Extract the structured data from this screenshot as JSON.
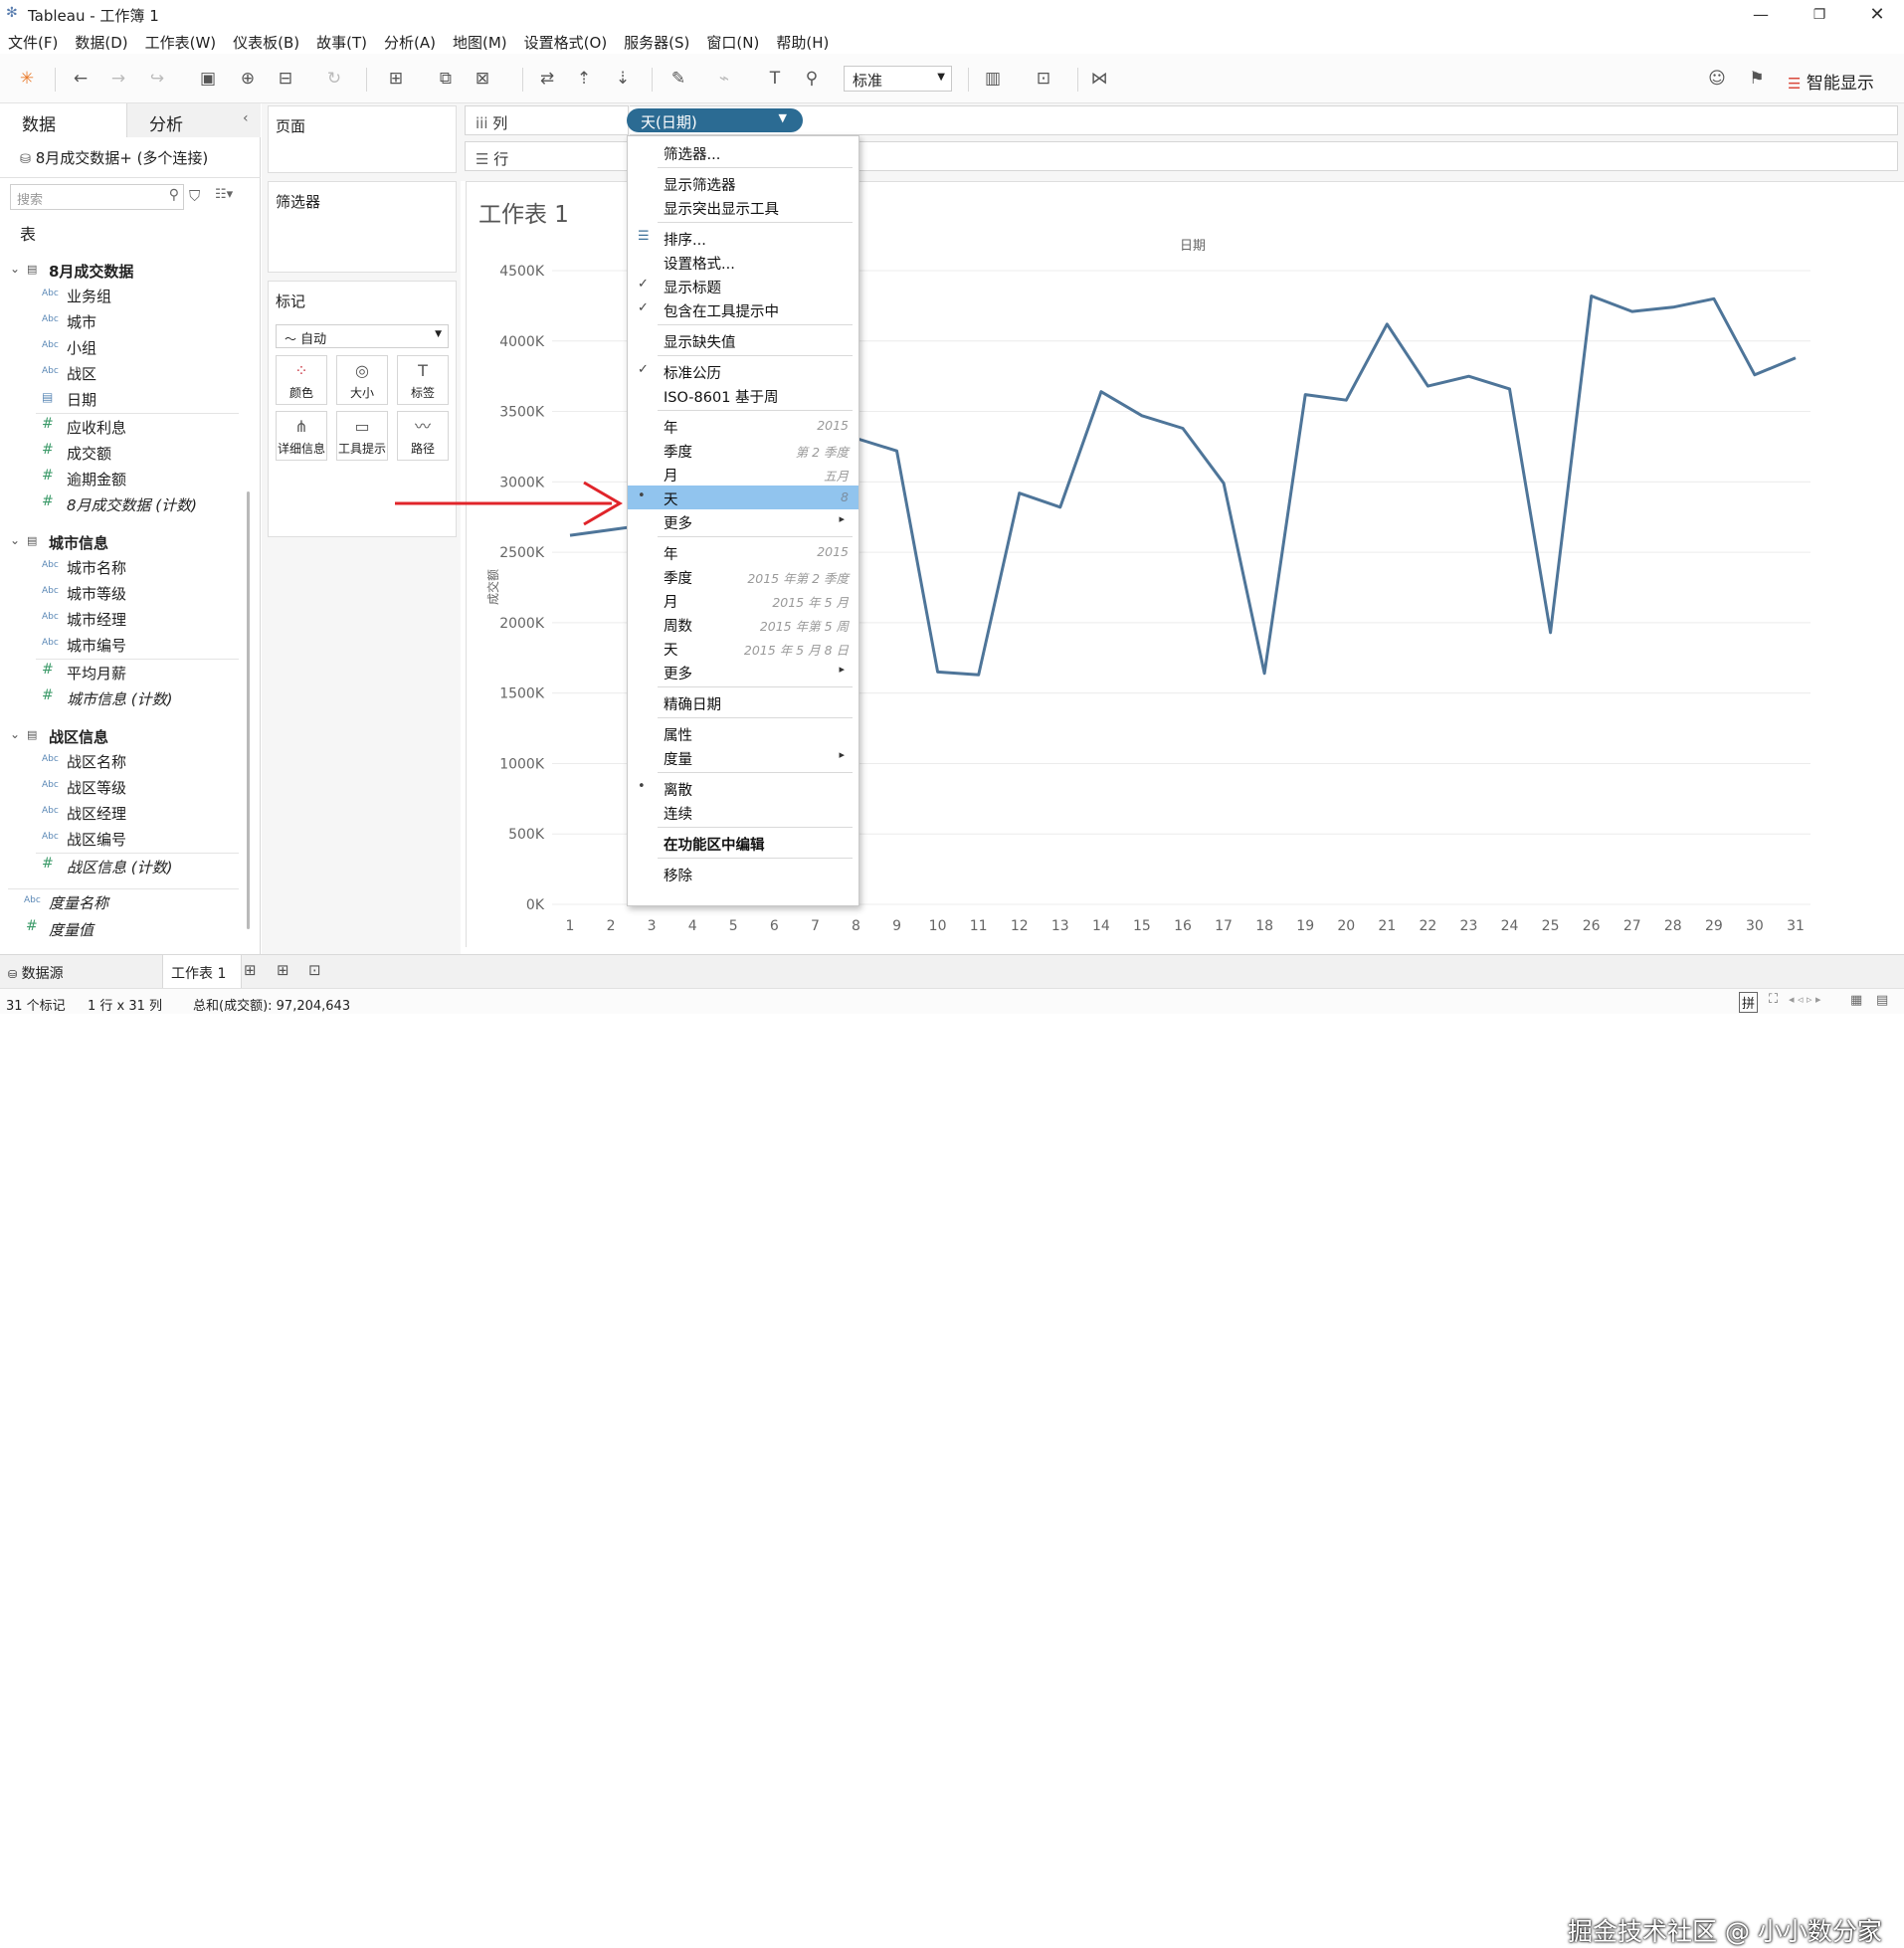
{
  "window": {
    "title": "Tableau - 工作簿 1"
  },
  "menubar": [
    "文件(F)",
    "数据(D)",
    "工作表(W)",
    "仪表板(B)",
    "故事(T)",
    "分析(A)",
    "地图(M)",
    "设置格式(O)",
    "服务器(S)",
    "窗口(N)",
    "帮助(H)"
  ],
  "toolbar": {
    "fit_select": "标准",
    "smart_show": "智能显示"
  },
  "left_panel": {
    "tab_data": "数据",
    "tab_analysis": "分析",
    "datasource": "8月成交数据+ (多个连接)",
    "search_placeholder": "搜索",
    "tables_label": "表",
    "tables": [
      {
        "name": "8月成交数据",
        "fields": [
          {
            "type": "Abc",
            "name": "业务组"
          },
          {
            "type": "Abc",
            "name": "城市"
          },
          {
            "type": "Abc",
            "name": "小组"
          },
          {
            "type": "Abc",
            "name": "战区"
          },
          {
            "type": "date",
            "name": "日期"
          },
          {
            "type": "#",
            "name": "应收利息"
          },
          {
            "type": "#",
            "name": "成交额"
          },
          {
            "type": "#",
            "name": "逾期金额"
          },
          {
            "type": "#",
            "name": "8月成交数据 (计数)"
          }
        ]
      },
      {
        "name": "城市信息",
        "fields": [
          {
            "type": "Abc",
            "name": "城市名称"
          },
          {
            "type": "Abc",
            "name": "城市等级"
          },
          {
            "type": "Abc",
            "name": "城市经理"
          },
          {
            "type": "Abc",
            "name": "城市编号"
          },
          {
            "type": "#",
            "name": "平均月薪"
          },
          {
            "type": "#",
            "name": "城市信息 (计数)"
          }
        ]
      },
      {
        "name": "战区信息",
        "fields": [
          {
            "type": "Abc",
            "name": "战区名称"
          },
          {
            "type": "Abc",
            "name": "战区等级"
          },
          {
            "type": "Abc",
            "name": "战区经理"
          },
          {
            "type": "Abc",
            "name": "战区编号"
          },
          {
            "type": "#",
            "name": "战区信息 (计数)"
          }
        ]
      }
    ],
    "measure_names": "度量名称",
    "measure_values": "度量值"
  },
  "shelves": {
    "pages": "页面",
    "filters": "筛选器",
    "marks": "标记",
    "mark_type": "自动",
    "mark_buttons": [
      "颜色",
      "大小",
      "标签",
      "详细信息",
      "工具提示",
      "路径"
    ],
    "columns": "列",
    "rows": "行",
    "column_pill": "天(日期)"
  },
  "sheet": {
    "title": "工作表 1"
  },
  "chart_data": {
    "type": "line",
    "title": "",
    "xlabel": "日期",
    "ylabel": "成交额",
    "x": [
      1,
      2,
      3,
      4,
      5,
      6,
      7,
      8,
      9,
      10,
      11,
      12,
      13,
      14,
      15,
      16,
      17,
      18,
      19,
      20,
      21,
      22,
      23,
      24,
      25,
      26,
      27,
      28,
      29,
      30,
      31
    ],
    "series": [
      {
        "name": "",
        "values": [
          2620,
          2660,
          2700,
          2900,
          3050,
          3150,
          3220,
          3310,
          3220,
          1650,
          1630,
          2920,
          2820,
          3640,
          3470,
          3380,
          2990,
          1640,
          3620,
          3580,
          4120,
          3680,
          3750,
          3660,
          1930,
          4320,
          4210,
          4240,
          4300,
          3760,
          3880
        ]
      }
    ],
    "ylim": [
      0,
      4500
    ],
    "yticks": [
      "0K",
      "500K",
      "1000K",
      "1500K",
      "2000K",
      "2500K",
      "3000K",
      "3500K",
      "4000K",
      "4500K"
    ],
    "line_color": "#4e7599",
    "grid": true
  },
  "context_menu": {
    "items": [
      {
        "label": "筛选器..."
      },
      {
        "sep": true
      },
      {
        "label": "显示筛选器"
      },
      {
        "label": "显示突出显示工具"
      },
      {
        "sep": true
      },
      {
        "label": "排序...",
        "icon": "sort"
      },
      {
        "label": "设置格式..."
      },
      {
        "label": "显示标题",
        "mark": "✓"
      },
      {
        "label": "包含在工具提示中",
        "mark": "✓"
      },
      {
        "sep": true
      },
      {
        "label": "显示缺失值"
      },
      {
        "sep": true
      },
      {
        "label": "标准公历",
        "mark": "✓"
      },
      {
        "label": "ISO-8601 基于周"
      },
      {
        "sep": true
      },
      {
        "label": "年",
        "right": "2015"
      },
      {
        "label": "季度",
        "right": "第 2 季度"
      },
      {
        "label": "月",
        "right": "五月"
      },
      {
        "label": "天",
        "right": "8",
        "mark": "•",
        "highlight": true
      },
      {
        "label": "更多",
        "sub": true
      },
      {
        "sep": true
      },
      {
        "label": "年",
        "right": "2015"
      },
      {
        "label": "季度",
        "right": "2015 年第 2 季度"
      },
      {
        "label": "月",
        "right": "2015 年 5 月"
      },
      {
        "label": "周数",
        "right": "2015 年第 5 周"
      },
      {
        "label": "天",
        "right": "2015 年 5 月 8 日"
      },
      {
        "label": "更多",
        "sub": true
      },
      {
        "sep": true
      },
      {
        "label": "精确日期"
      },
      {
        "sep": true
      },
      {
        "label": "属性"
      },
      {
        "label": "度量",
        "sub": true
      },
      {
        "sep": true
      },
      {
        "label": "离散",
        "mark": "•"
      },
      {
        "label": "连续"
      },
      {
        "sep": true
      },
      {
        "label": "在功能区中编辑",
        "bold": true
      },
      {
        "sep": true
      },
      {
        "label": "移除"
      }
    ]
  },
  "bottom": {
    "datasource_tab": "数据源",
    "sheet_tab": "工作表 1"
  },
  "status": {
    "marks": "31 个标记",
    "dims": "1 行 x 31 列",
    "sum": "总和(成交额): 97,204,643"
  },
  "watermark": "掘金技术社区 @ 小小数分家"
}
